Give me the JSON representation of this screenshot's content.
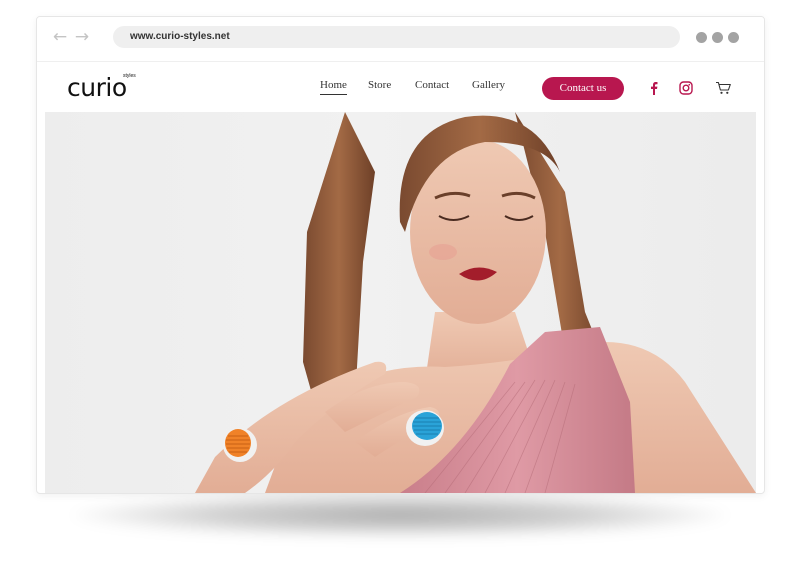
{
  "browser": {
    "url": "www.curio-styles.net",
    "back_icon": "arrow-left-icon",
    "forward_icon": "arrow-right-icon",
    "dots": 3
  },
  "site": {
    "logo": {
      "text": "curio",
      "sub": "styles"
    },
    "nav": [
      {
        "label": "Home",
        "active": true
      },
      {
        "label": "Store",
        "active": false
      },
      {
        "label": "Contact",
        "active": false
      },
      {
        "label": "Gallery",
        "active": false
      }
    ],
    "cta_label": "Contact us",
    "icons": [
      "facebook-icon",
      "instagram-icon",
      "cart-icon"
    ]
  },
  "colors": {
    "accent": "#b8174f",
    "hero_bg": "#eeeeee",
    "dress": "#d9949f"
  }
}
